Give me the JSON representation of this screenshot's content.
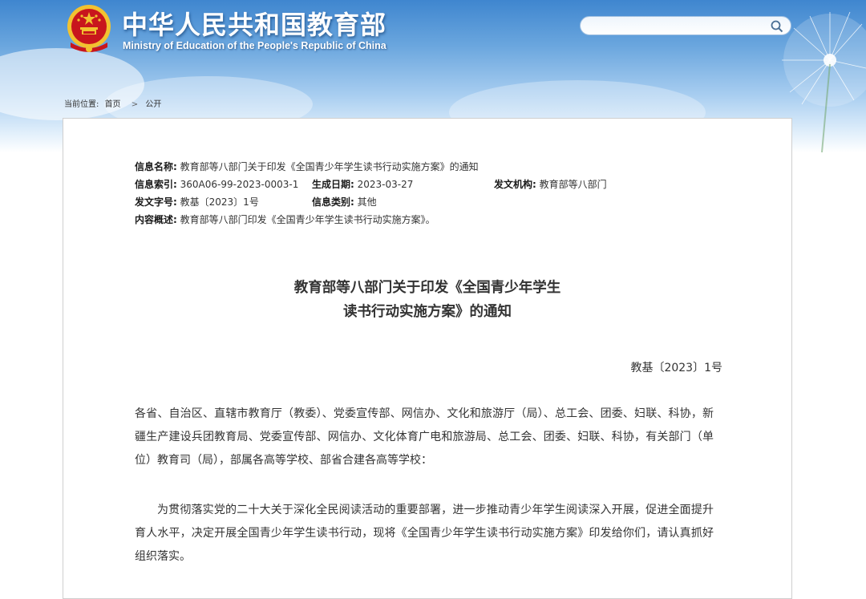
{
  "header": {
    "title": "中华人民共和国教育部",
    "subtitle": "Ministry of Education of the People's Republic of China",
    "search_placeholder": "",
    "emblem_icon": "national-emblem-icon",
    "search_icon": "search-icon"
  },
  "breadcrumb": {
    "prefix": "当前位置:",
    "items": [
      "首页",
      "公开"
    ],
    "separator": ">"
  },
  "meta": {
    "name_label": "信息名称:",
    "name_value": "教育部等八部门关于印发《全国青少年学生读书行动实施方案》的通知",
    "index_label": "信息索引:",
    "index_value": "360A06-99-2023-0003-1",
    "date_label": "生成日期:",
    "date_value": "2023-03-27",
    "org_label": "发文机构:",
    "org_value": "教育部等八部门",
    "docno_label": "发文字号:",
    "docno_value": "教基〔2023〕1号",
    "category_label": "信息类别:",
    "category_value": "其他",
    "summary_label": "内容概述:",
    "summary_value": "教育部等八部门印发《全国青少年学生读书行动实施方案》。"
  },
  "document": {
    "title_line1": "教育部等八部门关于印发《全国青少年学生",
    "title_line2": "读书行动实施方案》的通知",
    "number": "教基〔2023〕1号",
    "addressee": "各省、自治区、直辖市教育厅（教委）、党委宣传部、网信办、文化和旅游厅（局）、总工会、团委、妇联、科协，新疆生产建设兵团教育局、党委宣传部、网信办、文化体育广电和旅游局、总工会、团委、妇联、科协，有关部门（单位）教育司（局），部属各高等学校、部省合建各高等学校：",
    "body": "为贯彻落实党的二十大关于深化全民阅读活动的重要部署，进一步推动青少年学生阅读深入开展，促进全面提升育人水平，决定开展全国青少年学生读书行动，现将《全国青少年学生读书行动实施方案》印发给你们，请认真抓好组织落实。"
  },
  "colors": {
    "banner_top": "#3f86cf",
    "banner_bottom": "#dcecfa",
    "emblem_red": "#c8161d",
    "emblem_gold": "#f2c230",
    "text": "#333333"
  }
}
